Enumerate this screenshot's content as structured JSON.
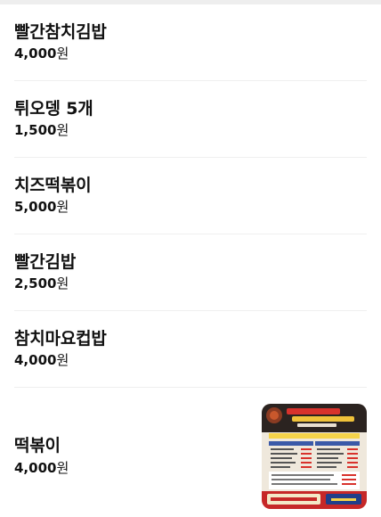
{
  "menu": {
    "currency": "원",
    "items": [
      {
        "name": "빨간참치김밥",
        "price": "4,000"
      },
      {
        "name": "튀오뎅 5개",
        "price": "1,500"
      },
      {
        "name": "치즈떡볶이",
        "price": "5,000"
      },
      {
        "name": "빨간김밥",
        "price": "2,500"
      },
      {
        "name": "참치마요컵밥",
        "price": "4,000"
      },
      {
        "name": "떡볶이",
        "price": "4,000"
      }
    ]
  }
}
